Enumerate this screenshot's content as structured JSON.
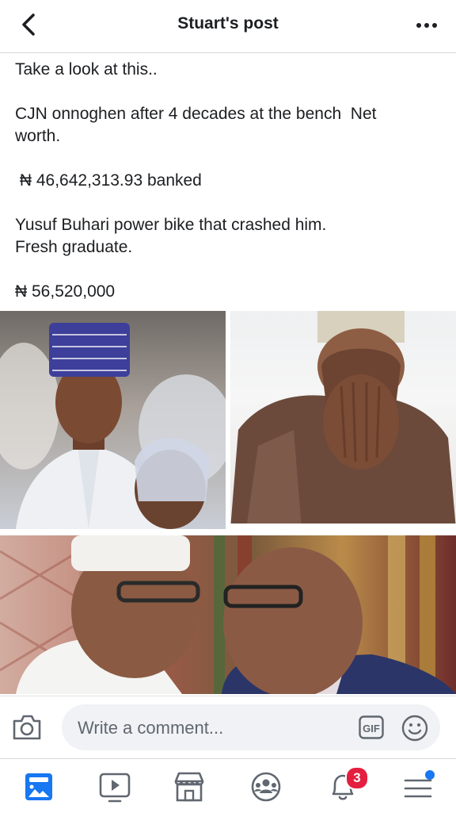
{
  "header": {
    "title": "Stuart's post",
    "icons": {
      "back": "chevron-left-icon",
      "more": "more-dots-icon"
    }
  },
  "post": {
    "lines": [
      "Take a look at this..",
      "",
      "CJN onnoghen after 4 decades at the bench  Net",
      "worth.",
      "",
      " ₦ 46,642,313.93 banked",
      "",
      "Yusuf Buhari power bike that crashed him.",
      "Fresh graduate.",
      "",
      "₦ 56,520,000"
    ]
  },
  "composer": {
    "placeholder": "Write a comment...",
    "gif_label": "GIF",
    "icons": {
      "camera": "camera-icon",
      "sticker": "smiley-icon"
    }
  },
  "bottom_nav": {
    "items": [
      {
        "name": "news-feed",
        "icon": "news-feed-icon",
        "active": true
      },
      {
        "name": "watch",
        "icon": "video-icon"
      },
      {
        "name": "marketplace",
        "icon": "marketplace-icon"
      },
      {
        "name": "groups",
        "icon": "groups-icon"
      },
      {
        "name": "notifications",
        "icon": "bell-icon",
        "badge": "3"
      },
      {
        "name": "menu",
        "icon": "hamburger-menu-icon"
      }
    ]
  },
  "colors": {
    "brand_blue": "#1877f2",
    "badge_red": "#e41e3f",
    "text": "#1c1e21",
    "muted": "#606770",
    "input_bg": "#f0f2f5"
  }
}
